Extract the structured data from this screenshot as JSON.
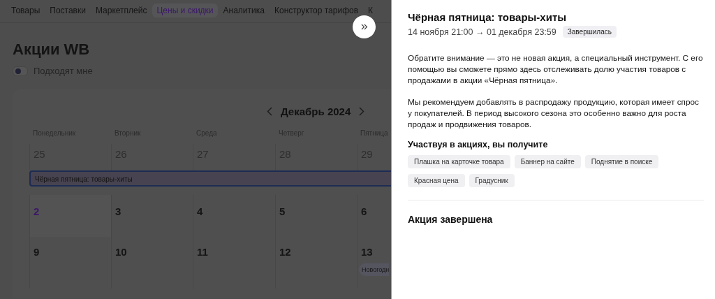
{
  "nav": {
    "tabs": [
      {
        "label": "Товары",
        "selected": false
      },
      {
        "label": "Поставки",
        "selected": false
      },
      {
        "label": "Маркетплейс",
        "selected": false
      },
      {
        "label": "Цены и скидки",
        "selected": true
      },
      {
        "label": "Аналитика",
        "selected": false
      },
      {
        "label": "Конструктор тарифов",
        "selected": false
      },
      {
        "label": "К",
        "selected": false
      }
    ]
  },
  "page": {
    "title": "Акции WB",
    "toggle": {
      "label": "Подходят мне",
      "on": false
    }
  },
  "calendar": {
    "month": "Декабрь 2024",
    "weekdays": [
      "Понедельник",
      "Вторник",
      "Среда",
      "Четверг",
      "Пятница"
    ],
    "weeks": [
      {
        "days": [
          {
            "date": "25",
            "muted": true,
            "selected": false
          },
          {
            "date": "26",
            "muted": true,
            "selected": false
          },
          {
            "date": "27",
            "muted": true,
            "selected": false
          },
          {
            "date": "28",
            "muted": true,
            "selected": false
          },
          {
            "date": "29",
            "muted": true,
            "selected": false
          }
        ],
        "span_event": {
          "title": "Чёрная пятница: товары-хиты",
          "selected": true
        }
      },
      {
        "days": [
          {
            "date": "2",
            "muted": false,
            "selected": true
          },
          {
            "date": "3",
            "muted": false,
            "selected": false
          },
          {
            "date": "4",
            "muted": false,
            "selected": false
          },
          {
            "date": "5",
            "muted": false,
            "selected": false
          },
          {
            "date": "6",
            "muted": false,
            "selected": false
          }
        ]
      },
      {
        "days": [
          {
            "date": "9",
            "muted": false,
            "selected": false
          },
          {
            "date": "10",
            "muted": false,
            "selected": false
          },
          {
            "date": "11",
            "muted": false,
            "selected": false
          },
          {
            "date": "12",
            "muted": false,
            "selected": false
          },
          {
            "date": "13",
            "muted": false,
            "selected": false,
            "event": {
              "title": "Новогодн"
            }
          }
        ]
      }
    ]
  },
  "panel": {
    "title": "Чёрная пятница: товары-хиты",
    "period": "14 ноября 21:00 → 01 декабря 23:59",
    "status": "Завершилась",
    "paragraphs": [
      "Обратите внимание — это не новая акция, а специальный инструмент. С его помощью вы сможете прямо здесь отслеживать долю участия товаров с продажами в акции «Чёрная пятница».",
      "Мы рекомендуем добавлять в распродажу продукцию, которая имеет спрос у покупателей. В период высокого сезона это особенно важно для роста продаж и продвижения товаров."
    ],
    "benefits_title": "Участвуя в акциях, вы получите",
    "benefits": [
      "Плашка на карточке товара",
      "Баннер на сайте",
      "Поднятие в поиске",
      "Красная цена",
      "Градусник"
    ],
    "footer_title": "Акция завершена"
  }
}
